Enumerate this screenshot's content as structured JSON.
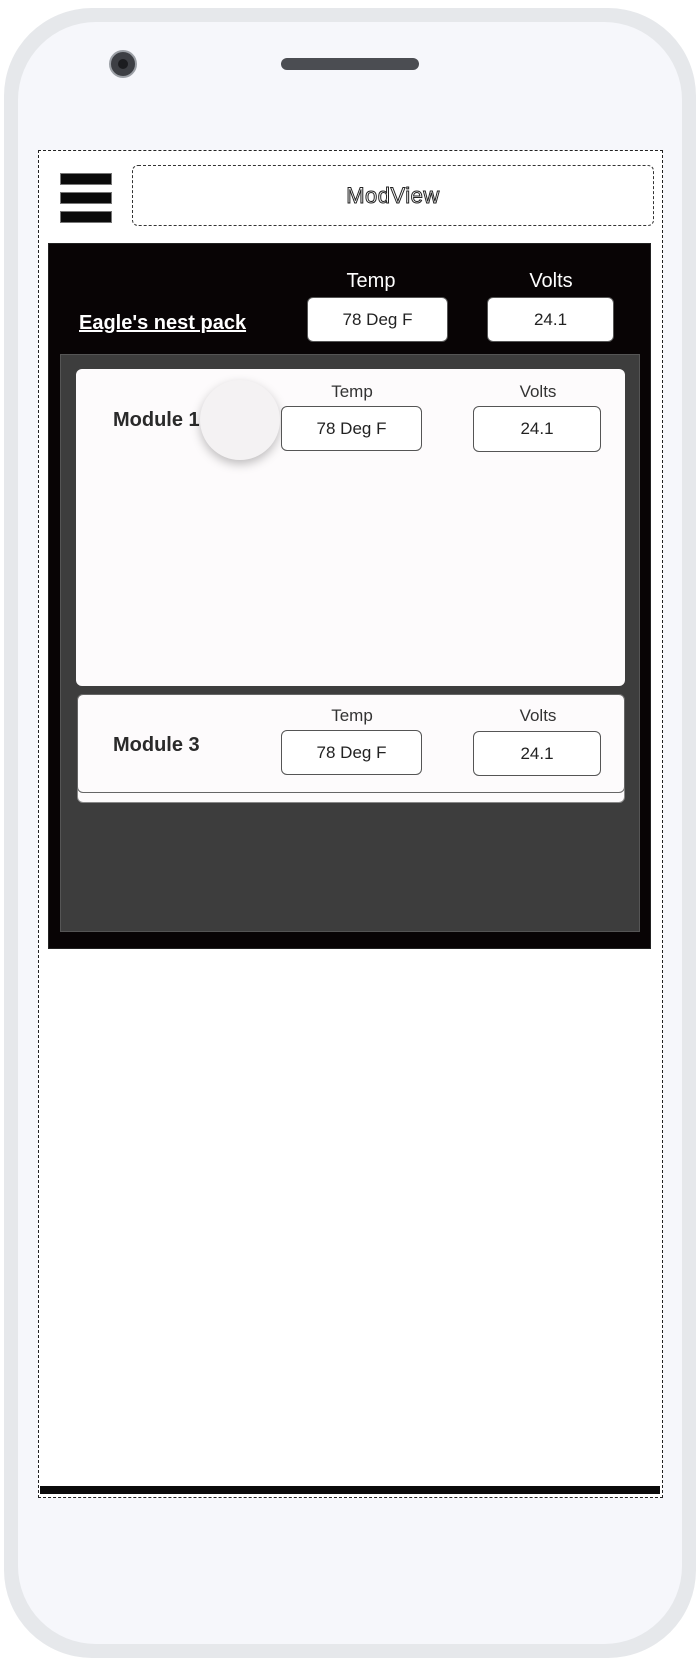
{
  "app": {
    "title": "ModView"
  },
  "pack": {
    "name": "Eagle's nest pack",
    "temp_label": "Temp",
    "volts_label": "Volts",
    "temp_value": "78 Deg F",
    "volts_value": "24.1"
  },
  "modules": [
    {
      "name": "Module 1",
      "temp_label": "Temp",
      "volts_label": "Volts",
      "temp_value": "78 Deg F",
      "volts_value": "24.1"
    },
    {
      "name": "Module 3",
      "temp_label": "Temp",
      "volts_label": "Volts",
      "temp_value": "78 Deg F",
      "volts_value": "24.1"
    }
  ],
  "icons": {
    "menu": "hamburger-menu-icon"
  },
  "colors": {
    "pack_bg": "#080405",
    "modules_bg": "#3d3d3d",
    "card_bg": "#fdfbfc"
  }
}
